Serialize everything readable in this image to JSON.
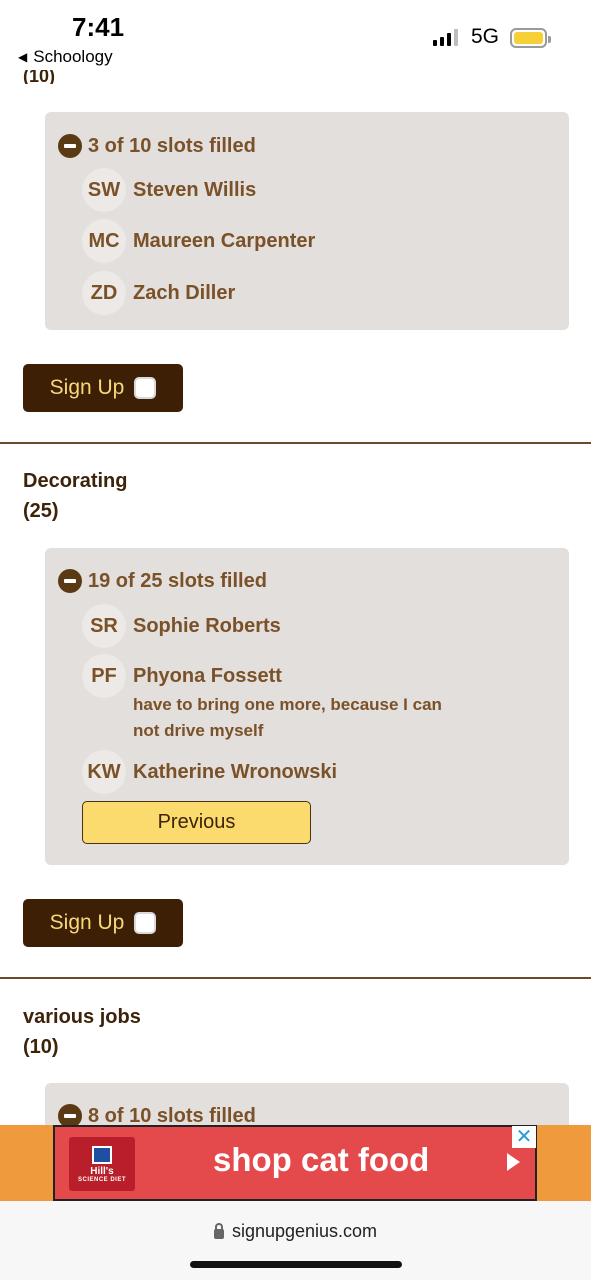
{
  "status_bar": {
    "time": "7:41",
    "back_app": "Schoology",
    "network": "5G",
    "battery_color": "#f7d037"
  },
  "cut_off_label": "(10)",
  "sections": [
    {
      "filled_text": "3 of 10 slots filled",
      "people": [
        {
          "initials": "SW",
          "name": "Steven Willis"
        },
        {
          "initials": "MC",
          "name": "Maureen Carpenter"
        },
        {
          "initials": "ZD",
          "name": "Zach Diller"
        }
      ],
      "signup_label": "Sign Up"
    },
    {
      "title": "Decorating",
      "count": "(25)",
      "filled_text": "19 of 25 slots filled",
      "people": [
        {
          "initials": "SR",
          "name": "Sophie Roberts"
        },
        {
          "initials": "PF",
          "name": "Phyona Fossett",
          "comment": "have to bring one more, because I can not drive myself"
        },
        {
          "initials": "KW",
          "name": "Katherine Wronowski"
        }
      ],
      "previous_label": "Previous",
      "signup_label": "Sign Up"
    },
    {
      "title": "various jobs",
      "count": "(10)",
      "filled_text": "8 of 10 slots filled"
    }
  ],
  "ad": {
    "text": "shop cat food",
    "brand": "Hill's",
    "brand_sub": "SCIENCE DIET",
    "close": "✕"
  },
  "browser": {
    "url": "signupgenius.com"
  },
  "colors": {
    "accent_dark": "#3d1f05",
    "slot_box_bg": "#e2dfdc",
    "text_brown": "#7a5128",
    "previous_button": "#fbdb6e",
    "ad_red": "#e44a4c",
    "ad_orange": "#f09a3e"
  }
}
